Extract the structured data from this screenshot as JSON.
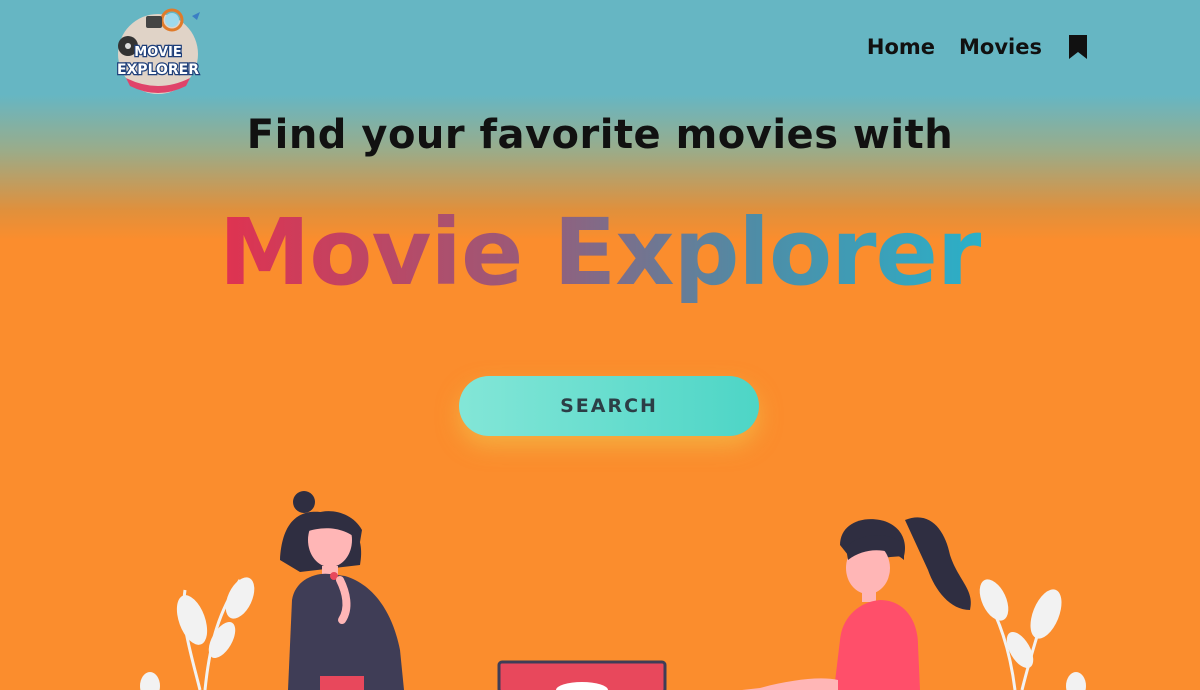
{
  "logo": {
    "line1": "MOVIE",
    "line2": "EXPLORER"
  },
  "nav": {
    "home": "Home",
    "movies": "Movies",
    "bookmark_icon": "bookmark-icon"
  },
  "hero": {
    "headline": "Find your favorite movies with",
    "brand": "Movie Explorer",
    "search_label": "SEARCH"
  },
  "colors": {
    "nav_bg": "#66b6c3",
    "page_bg": "#fb8d2d",
    "brand_start": "#e03250",
    "brand_end": "#2bb0c8",
    "button": "#5fdcce"
  }
}
